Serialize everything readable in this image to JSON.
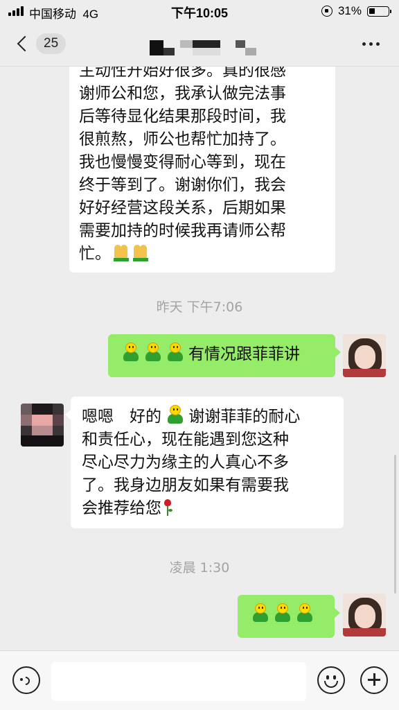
{
  "status_bar": {
    "carrier": "中国移动",
    "network": "4G",
    "time": "下午10:05",
    "battery_percent": "31%",
    "battery_level": 0.31
  },
  "nav": {
    "unread_count": "25",
    "more_icon": "more-dots-icon"
  },
  "messages": {
    "m1": {
      "lines": [
        "主动性开始好很多。真的很感",
        "谢师公和您，我承认做完法事",
        "后等待显化结果那段时间，我",
        "很煎熬，师公也帮忙加持了。",
        "我也慢慢变得耐心等到，现在",
        "终于等到了。谢谢你们，我会",
        "好好经营这段关系，后期如果",
        "需要加持的时候我再请师公帮",
        "忙。"
      ],
      "emoji": "pray-emoji"
    },
    "ts1": "昨天 下午7:06",
    "m2": {
      "text": "有情况跟菲菲讲",
      "emoji": "doll-emoji",
      "emoji_count": 3
    },
    "m3": {
      "line1_a": "嗯嗯　好的",
      "line1_b": "谢谢菲菲的耐心",
      "lines": [
        "和责任心，现在能遇到您这种",
        "尽心尽力为缘主的人真心不多",
        "了。我身边朋友如果有需要我"
      ],
      "last_line": "会推荐给您",
      "trailing_emoji": "rose-emoji"
    },
    "ts2": "凌晨 1:30",
    "m4": {
      "emoji": "doll-emoji",
      "emoji_count": 3
    }
  },
  "input_bar": {
    "voice_icon": "voice-icon",
    "emoji_icon": "smiley-icon",
    "plus_icon": "plus-icon",
    "text_value": ""
  },
  "colors": {
    "background": "#ededed",
    "bubble_sent": "#95ec69",
    "bubble_received": "#ffffff",
    "timestamp": "#a3a3a3"
  }
}
